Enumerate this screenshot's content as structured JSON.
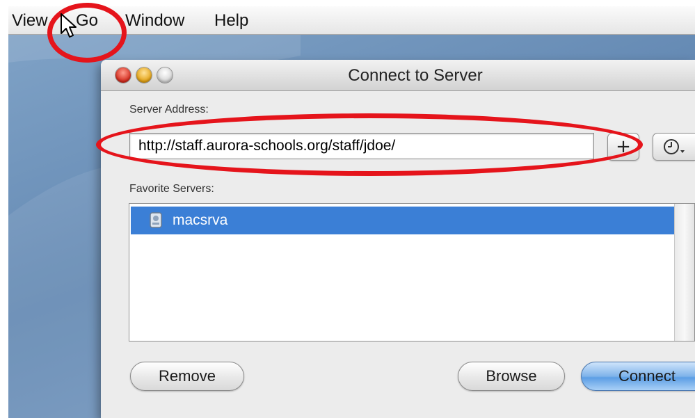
{
  "menubar": {
    "items": [
      {
        "label": "View"
      },
      {
        "label": "Go"
      },
      {
        "label": "Window"
      },
      {
        "label": "Help"
      }
    ]
  },
  "window": {
    "title": "Connect to Server",
    "server_address_label": "Server Address:",
    "server_address_value": "http://staff.aurora-schools.org/staff/jdoe/",
    "favorites_label": "Favorite Servers:",
    "favorites": [
      {
        "name": "macsrva",
        "icon": "server-icon",
        "selected": true
      }
    ],
    "add_button_label": "+",
    "recent_icon": "clock-icon",
    "buttons": {
      "remove": "Remove",
      "browse": "Browse",
      "connect": "Connect"
    }
  },
  "colors": {
    "selection": "#3b7fd6",
    "annotation": "#e5141b",
    "desktop": "#6f93bb",
    "connect_button": "#6aa6e8"
  }
}
